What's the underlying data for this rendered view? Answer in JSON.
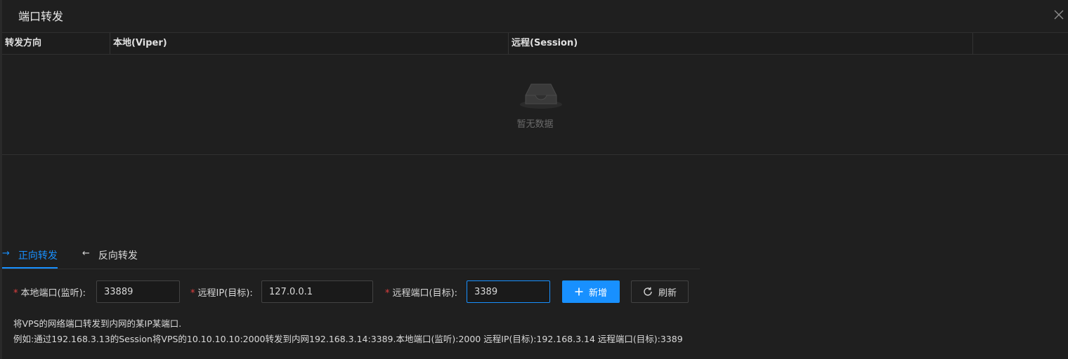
{
  "modal": {
    "title": "端口转发"
  },
  "table": {
    "columns": [
      "转发方向",
      "本地(Viper)",
      "远程(Session)"
    ],
    "empty_text": "暂无数据"
  },
  "tabs": [
    {
      "arrow": "→",
      "label": "正向转发",
      "active": true
    },
    {
      "arrow": "←",
      "label": "反向转发",
      "active": false
    }
  ],
  "form": {
    "local_port": {
      "label": "本地端口(监听):",
      "value": "33889"
    },
    "remote_ip": {
      "label": "远程IP(目标):",
      "value": "127.0.0.1"
    },
    "remote_port": {
      "label": "远程端口(目标):",
      "value": "3389"
    },
    "add_label": "新增",
    "refresh_label": "刷新"
  },
  "help": {
    "line1": "将VPS的网络端口转发到内网的某IP某端口.",
    "line2": "例如:通过192.168.3.13的Session将VPS的10.10.10.10:2000转发到内网192.168.3.14:3389.本地端口(监听):2000 远程IP(目标):192.168.3.14 远程端口(目标):3389"
  },
  "colors": {
    "accent": "#1890ff",
    "required": "#e04040",
    "background": "#1f1f1f"
  },
  "icons": [
    "close-icon",
    "empty-inbox-icon",
    "arrow-right-icon",
    "arrow-left-icon",
    "plus-icon",
    "refresh-icon"
  ]
}
